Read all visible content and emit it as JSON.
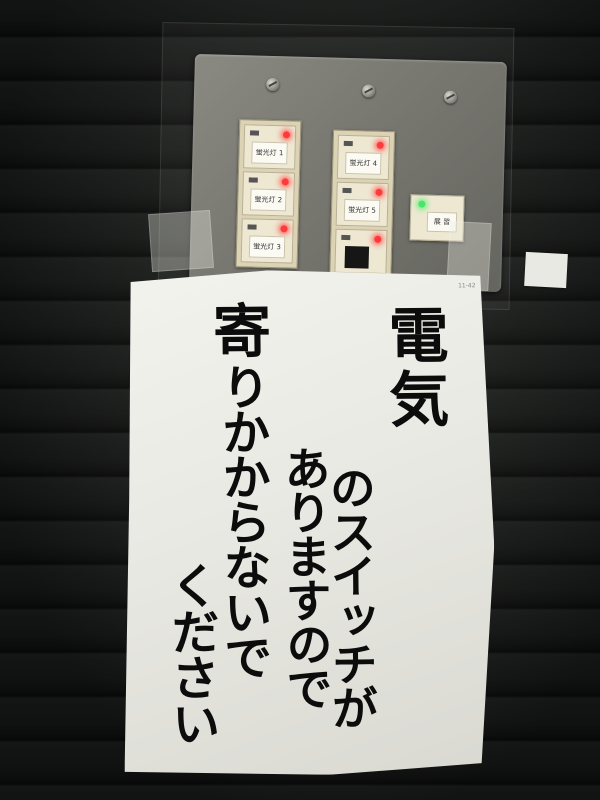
{
  "panel": {
    "bank_left": [
      {
        "label": "蛍光灯 1",
        "led": "red"
      },
      {
        "label": "蛍光灯 2",
        "led": "red"
      },
      {
        "label": "蛍光灯 3",
        "led": "red"
      }
    ],
    "bank_middle": [
      {
        "label": "蛍光灯 4",
        "led": "red"
      },
      {
        "label": "蛍光灯 5",
        "led": "red"
      },
      {
        "label": "",
        "led": "red"
      }
    ],
    "single_switch": {
      "label": "展 習",
      "led": "green"
    },
    "led_colors": {
      "red": "#ff3a3a",
      "green": "#45e66a"
    }
  },
  "sign": {
    "line1": "電気",
    "line2": "のスイッチが",
    "line3": "ありますので",
    "line4_head": "寄",
    "line4_rest": "りかからないで",
    "line5": "ください",
    "fine_print": "11-42"
  }
}
